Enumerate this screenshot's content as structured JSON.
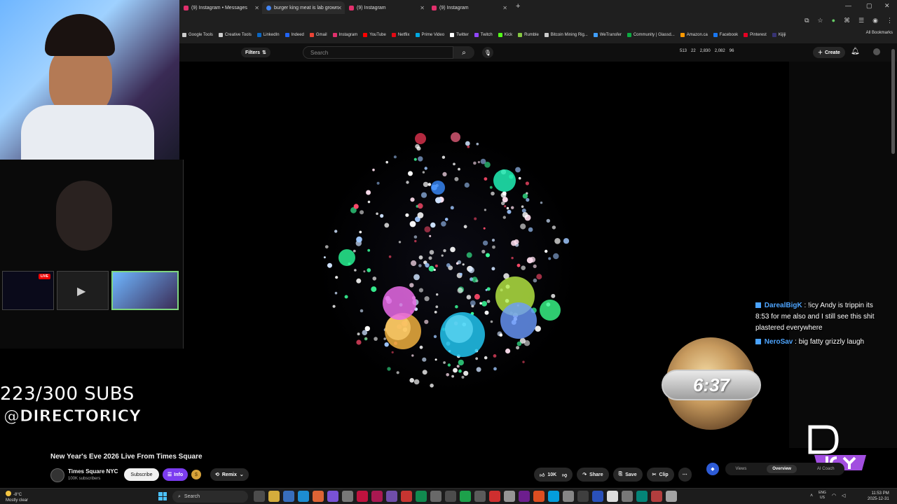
{
  "browser": {
    "tabs": [
      {
        "label": "(9) Instagram • Messages",
        "color": "#e1306c"
      },
      {
        "label": "burger king meat is lab grown",
        "color": "#4285f4"
      },
      {
        "label": "(9) Instagram",
        "color": "#e1306c"
      },
      {
        "label": "(9) Instagram",
        "color": "#e1306c"
      }
    ],
    "bookmarks": [
      {
        "label": "Google Tools",
        "color": "#ccc"
      },
      {
        "label": "Creative Tools",
        "color": "#ccc"
      },
      {
        "label": "LinkedIn",
        "color": "#0a66c2"
      },
      {
        "label": "Indeed",
        "color": "#2164f3"
      },
      {
        "label": "Gmail",
        "color": "#ea4335"
      },
      {
        "label": "Instagram",
        "color": "#e1306c"
      },
      {
        "label": "YouTube",
        "color": "#ff0000"
      },
      {
        "label": "Netflix",
        "color": "#e50914"
      },
      {
        "label": "Prime Video",
        "color": "#00a8e1"
      },
      {
        "label": "Twitter",
        "color": "#ffffff"
      },
      {
        "label": "Twitch",
        "color": "#9146ff"
      },
      {
        "label": "Kick",
        "color": "#53fc18"
      },
      {
        "label": "Rumble",
        "color": "#85c742"
      },
      {
        "label": "Bitcoin Mining Rig...",
        "color": "#ccc"
      },
      {
        "label": "WeTransfer",
        "color": "#409fff"
      },
      {
        "label": "Community | Glassd...",
        "color": "#0caa41"
      },
      {
        "label": "Amazon.ca",
        "color": "#ff9900"
      },
      {
        "label": "Facebook",
        "color": "#1877f2"
      },
      {
        "label": "Pinterest",
        "color": "#e60023"
      },
      {
        "label": "Kijiji",
        "color": "#373373"
      }
    ],
    "all_bookmarks": "All Bookmarks"
  },
  "youtube": {
    "filters_label": "Filters",
    "search_placeholder": "Search",
    "stats": [
      "513",
      "22",
      "2,830",
      "2,082",
      "96"
    ],
    "create_label": "Create",
    "video_title": "New Year's Eve 2026 Live From Times Square",
    "channel_name": "Times Square NYC",
    "channel_subs": "100K subscribers",
    "subscribe_label": "Subscribe",
    "info_label": "Info",
    "remix_label": "Remix",
    "like_count": "10K",
    "share_label": "Share",
    "save_label": "Save",
    "clip_label": "Clip",
    "ai_tabs": [
      "Views",
      "Overview",
      "AI Coach"
    ]
  },
  "stream": {
    "subs_goal": "223/300 SUBS",
    "handle": "@DIRECTORICY",
    "live_badge": "LIVE",
    "countdown": "6:37",
    "chat": [
      {
        "user": "DarealBigK",
        "text": ": !icy Andy is trippin its 8:53 for me also and I still see this shit plastered everywhere"
      },
      {
        "user": "NeroSav",
        "text": ": big fatty grizzly laugh"
      }
    ]
  },
  "taskbar": {
    "temp": "-8°C",
    "weather": "Mostly clear",
    "search_label": "Search",
    "lang": "ENG",
    "region": "US",
    "time": "11:53 PM",
    "date": "2025-12-31"
  }
}
